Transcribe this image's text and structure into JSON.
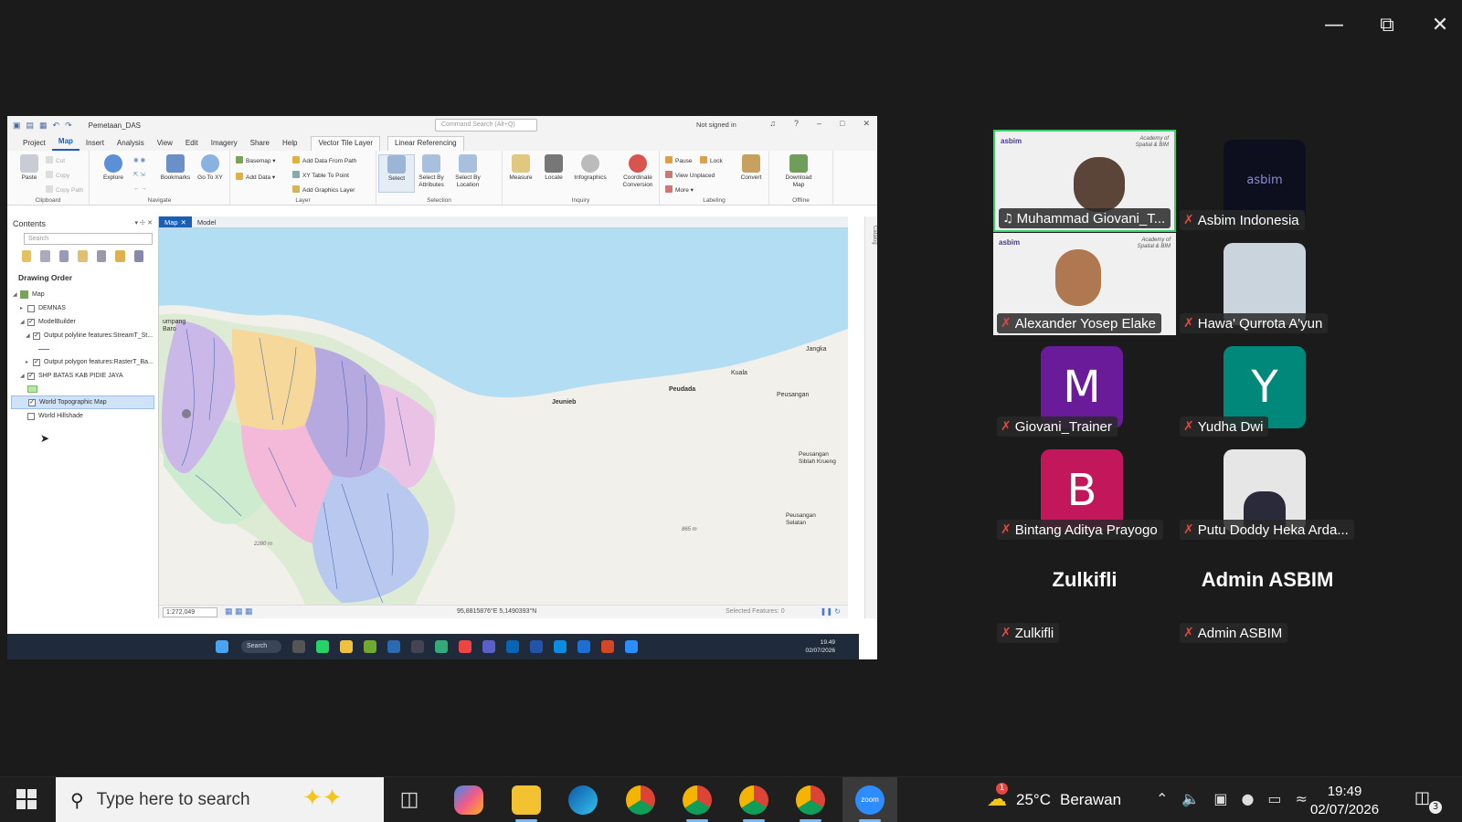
{
  "zoom": {
    "window_controls": [
      "minimize",
      "restore",
      "close"
    ]
  },
  "arcgis": {
    "project_name": "Pemetaan_DAS",
    "command_search_placeholder": "Command Search (Alt+Q)",
    "signin_status": "Not signed in",
    "ribbon_tabs": [
      "Project",
      "Map",
      "Insert",
      "Analysis",
      "View",
      "Edit",
      "Imagery",
      "Share",
      "Help"
    ],
    "contextual_tabs": [
      "Vector Tile Layer",
      "Linear Referencing"
    ],
    "clipboard": {
      "paste": "Paste",
      "cut": "Cut",
      "copy": "Copy",
      "copy_path": "Copy Path",
      "label": "Clipboard"
    },
    "navigate": {
      "explore": "Explore",
      "bookmarks": "Bookmarks",
      "go_to_xy": "Go To XY",
      "label": "Navigate"
    },
    "layer": {
      "basemap": "Basemap",
      "add_data": "Add Data",
      "add_data_from_path": "Add Data From Path",
      "xy_table": "XY Table To Point",
      "add_graphics": "Add Graphics Layer",
      "label": "Layer"
    },
    "selection": {
      "select": "Select",
      "by_attributes": "Select By Attributes",
      "by_location": "Select By Location",
      "label": "Selection"
    },
    "inquiry": {
      "measure": "Measure",
      "locate": "Locate",
      "infographics": "Infographics",
      "coord_conv": "Coordinate Conversion",
      "label": "Inquiry"
    },
    "labeling": {
      "pause": "Pause",
      "lock": "Lock",
      "view_unplaced": "View Unplaced",
      "more": "More",
      "convert": "Convert",
      "label": "Labeling"
    },
    "offline": {
      "download": "Download Map",
      "label": "Offline"
    },
    "contents": {
      "title": "Contents",
      "search_placeholder": "Search",
      "drawing_order": "Drawing Order",
      "layers": [
        {
          "name": "Map",
          "checked": true
        },
        {
          "name": "DEMNAS",
          "checked": false
        },
        {
          "name": "ModelBuilder",
          "checked": true
        },
        {
          "name": "Output polyline features:StreamT_St...",
          "checked": true
        },
        {
          "name": "Output polygon features:RasterT_Ba...",
          "checked": true
        },
        {
          "name": "SHP BATAS KAB PIDIE JAYA",
          "checked": true
        },
        {
          "name": "World Topographic Map",
          "checked": true
        },
        {
          "name": "World Hillshade",
          "checked": false
        }
      ]
    },
    "map_tabs": [
      "Map",
      "Model"
    ],
    "map_labels": {
      "bl": "umpang\nBaro",
      "jeunieb": "Jeunieb",
      "peudada": "Peudada",
      "kuala": "Kuala",
      "peusangan": "Peusangan",
      "jangka": "Jangka",
      "peusangan_sk": "Peusangan Siblah Krueng",
      "peusangan_sel": "Peusangan Selatan",
      "elev1": "2280 m",
      "elev2": "865 m"
    },
    "scale": "1:272,049",
    "coordinates": "95,8815876°E 5,1490393°N",
    "selected_features": "Selected Features: 0",
    "catalog": "Catalog",
    "inner_taskbar": {
      "search": "Search",
      "time": "19.49",
      "date": "02/07/2026"
    }
  },
  "participants": [
    {
      "name": "Muhammad Giovani_T...",
      "type": "video",
      "active": true,
      "muted": false
    },
    {
      "name": "Asbim Indonesia",
      "type": "logo",
      "muted": true
    },
    {
      "name": "Alexander Yosep Elake",
      "type": "video",
      "muted": true
    },
    {
      "name": "Hawa' Qurrota A'yun",
      "type": "photo",
      "muted": true
    },
    {
      "name": "Giovani_Trainer",
      "type": "letter",
      "letter": "M",
      "color": "#6a1b9a",
      "muted": true
    },
    {
      "name": "Yudha Dwi",
      "type": "letter",
      "letter": "Y",
      "color": "#00897b",
      "muted": true
    },
    {
      "name": "Bintang Aditya Prayogo",
      "type": "letter",
      "letter": "B",
      "color": "#c2185b",
      "muted": true
    },
    {
      "name": "Putu Doddy Heka Arda...",
      "type": "photo",
      "muted": true
    },
    {
      "name": "Zulkifli",
      "type": "text",
      "muted": true
    },
    {
      "name": "Admin ASBIM",
      "type": "text",
      "muted": true
    }
  ],
  "tile_brand": {
    "logo": "asbim",
    "academy": "Academy of\nSpatial & BIM"
  },
  "taskbar": {
    "search_placeholder": "Type here to search",
    "weather": {
      "temp": "25°C",
      "desc": "Berawan",
      "alert": "1"
    },
    "time": "19:49",
    "date": "02/07/2026",
    "notifications": "3"
  }
}
